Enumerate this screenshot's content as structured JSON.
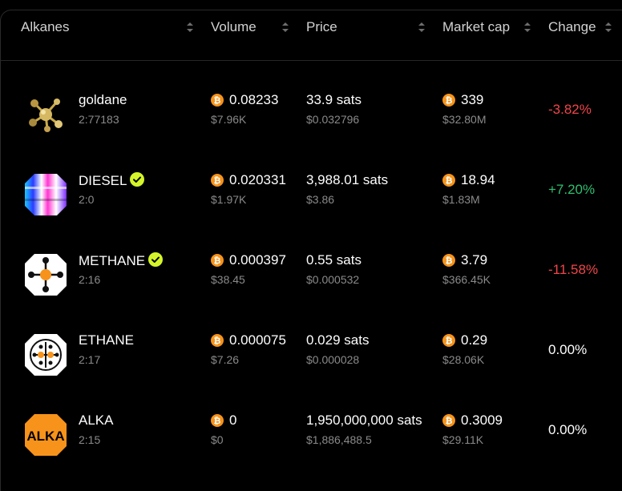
{
  "table": {
    "columns": [
      {
        "label": "Alkanes"
      },
      {
        "label": "Volume"
      },
      {
        "label": "Price"
      },
      {
        "label": "Market cap"
      },
      {
        "label": "Change"
      }
    ],
    "rows": [
      {
        "name": "goldane",
        "id": "2:77183",
        "verified": false,
        "logo": "goldane-molecule-icon",
        "volume_btc": "0.08233",
        "volume_usd": "$7.96K",
        "price_sats": "33.9 sats",
        "price_usd": "$0.032796",
        "mcap_btc": "339",
        "mcap_usd": "$32.80M",
        "change": "-3.82%",
        "change_color": "#f0454b"
      },
      {
        "name": "DIESEL",
        "id": "2:0",
        "verified": true,
        "logo": "diesel-gradient-hexagon-icon",
        "volume_btc": "0.020331",
        "volume_usd": "$1.97K",
        "price_sats": "3,988.01 sats",
        "price_usd": "$3.86",
        "mcap_btc": "18.94",
        "mcap_usd": "$1.83M",
        "change": "+7.20%",
        "change_color": "#2fbf71"
      },
      {
        "name": "METHANE",
        "id": "2:16",
        "verified": true,
        "logo": "methane-molecule-hexagon-icon",
        "volume_btc": "0.000397",
        "volume_usd": "$38.45",
        "price_sats": "0.55 sats",
        "price_usd": "$0.000532",
        "mcap_btc": "3.79",
        "mcap_usd": "$366.45K",
        "change": "-11.58%",
        "change_color": "#f0454b"
      },
      {
        "name": "ETHANE",
        "id": "2:17",
        "verified": false,
        "logo": "ethane-molecule-hexagon-icon",
        "volume_btc": "0.000075",
        "volume_usd": "$7.26",
        "price_sats": "0.029 sats",
        "price_usd": "$0.000028",
        "mcap_btc": "0.29",
        "mcap_usd": "$28.06K",
        "change": "0.00%",
        "change_color": "#ffffff"
      },
      {
        "name": "ALKA",
        "id": "2:15",
        "verified": false,
        "logo": "alka-orange-hexagon-icon",
        "logo_text": "ALKA",
        "volume_btc": "0",
        "volume_usd": "$0",
        "price_sats": "1,950,000,000 sats",
        "price_usd": "$1,886,488.5",
        "mcap_btc": "0.3009",
        "mcap_usd": "$29.11K",
        "change": "0.00%",
        "change_color": "#ffffff"
      }
    ]
  },
  "colors": {
    "background": "#000000",
    "bitcoin": "#f7931a",
    "verified": "#d4f52a",
    "negative": "#f0454b",
    "positive": "#2fbf71",
    "muted": "#8a8a8a"
  }
}
